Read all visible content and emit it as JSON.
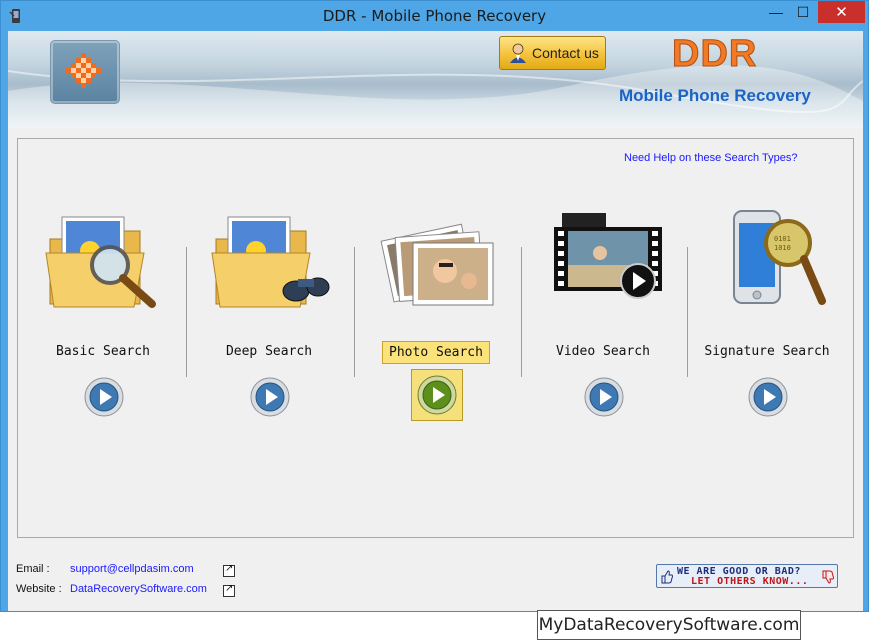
{
  "window": {
    "title": "DDR - Mobile Phone Recovery",
    "minimize_glyph": "—",
    "maximize_glyph": "☐",
    "close_glyph": "✕"
  },
  "header": {
    "contact_label": "Contact us",
    "brand": "DDR",
    "subtitle": "Mobile Phone Recovery"
  },
  "panel": {
    "help_link": "Need Help on these Search Types?",
    "options": [
      {
        "label": "Basic Search",
        "icon": "folder-magnifier-icon",
        "selected": false
      },
      {
        "label": "Deep Search",
        "icon": "folder-binoculars-icon",
        "selected": false
      },
      {
        "label": "Photo Search",
        "icon": "photos-stack-icon",
        "selected": true
      },
      {
        "label": "Video Search",
        "icon": "film-strip-icon",
        "selected": false
      },
      {
        "label": "Signature Search",
        "icon": "phone-magnifier-icon",
        "selected": false
      }
    ]
  },
  "footer": {
    "email_label": "Email :",
    "email_value": "support@cellpdasim.com",
    "website_label": "Website :",
    "website_value": "DataRecoverySoftware.com",
    "rate_line1": "WE ARE GOOD OR BAD?",
    "rate_line2": "LET OTHERS KNOW..."
  },
  "watermark": "MyDataRecoverySoftware.com",
  "colors": {
    "accent": "#f07a25",
    "link": "#1a1aff",
    "frame": "#4ea6e6",
    "selected_bg": "#fbe27a"
  }
}
